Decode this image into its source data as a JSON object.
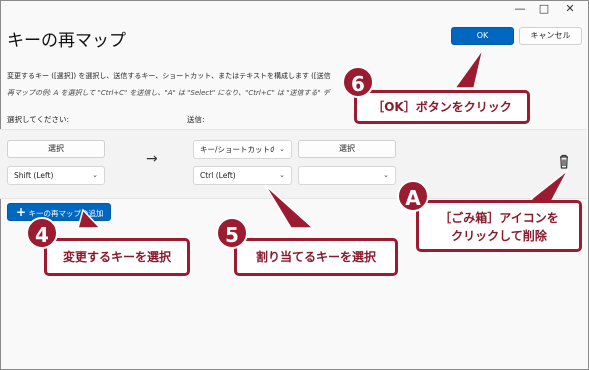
{
  "window": {
    "title": "キーの再マップ",
    "ok_label": "OK",
    "cancel_label": "キャンセル",
    "minimize_glyph": "—",
    "maximize_glyph": "□",
    "close_glyph": "✕"
  },
  "description": {
    "line1": "変更するキー ([選択]) を選択し、送信するキー、ショートカット、またはテキストを構成します ([送信",
    "line2": "再マップの例: A を選択して \"Ctrl+C\" を送信し、\"A\" は \"Select\" になり、\"Ctrl+C\" は \"送信する\" デ"
  },
  "columns": {
    "select": "選択してください:",
    "send": "送信:"
  },
  "row": {
    "select_button": "選択",
    "select_value": "Shift (Left)",
    "arrow": "→",
    "type_value": "キー/ショートカットの送",
    "send_select_button": "選択",
    "send_value": "Ctrl (Left)",
    "send_value2": "",
    "delete_icon": "trash-icon"
  },
  "add_button": {
    "plus": "+",
    "label": "キーの再マップの追加"
  },
  "annotations": {
    "step4": {
      "number": "4",
      "text": "変更するキーを選択"
    },
    "step5": {
      "number": "5",
      "text": "割り当てるキーを選択"
    },
    "step6": {
      "number": "6",
      "text": "［OK］ボタンをクリック"
    },
    "stepA": {
      "number": "A",
      "text_line1": "［ごみ箱］アイコンを",
      "text_line2": "クリックして削除"
    }
  },
  "colors": {
    "accent": "#0067c0",
    "callout": "#9b1b30"
  }
}
